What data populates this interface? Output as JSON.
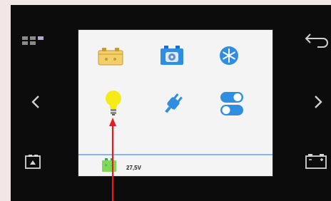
{
  "device": {
    "left_buttons": [
      {
        "name": "menu-grid-button",
        "icon": "grid-icon"
      },
      {
        "name": "prev-button",
        "icon": "chevron-left-icon"
      },
      {
        "name": "left-battery-button",
        "icon": "battery-icon"
      }
    ],
    "right_buttons": [
      {
        "name": "back-button",
        "icon": "return-arrow-icon"
      },
      {
        "name": "next-button",
        "icon": "chevron-right-icon"
      },
      {
        "name": "right-battery-button",
        "icon": "battery-icon"
      }
    ]
  },
  "screen": {
    "menu_icons": [
      {
        "name": "solar-battery-icon",
        "color": "#f0c85a"
      },
      {
        "name": "battery-settings-icon",
        "color": "#2f8ee0"
      },
      {
        "name": "snowflake-icon",
        "color": "#2f8ee0"
      },
      {
        "name": "light-bulb-icon",
        "color": "#f6ea18"
      },
      {
        "name": "plug-icon",
        "color": "#2f8ee0"
      },
      {
        "name": "toggle-switch-icon",
        "color": "#2f8ee0"
      }
    ],
    "status_bar": {
      "battery_voltage": "27,5V",
      "battery_color": "#7ed957"
    }
  },
  "annotation": {
    "arrow_color": "#e31c23"
  }
}
